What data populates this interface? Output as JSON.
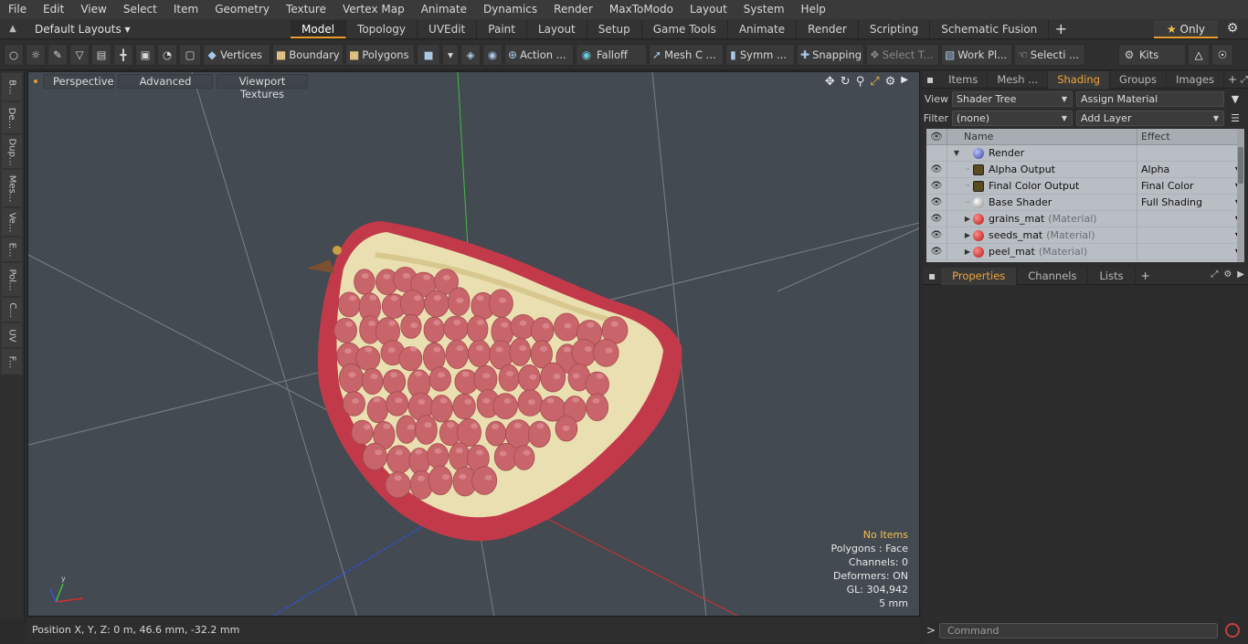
{
  "menu": [
    "File",
    "Edit",
    "View",
    "Select",
    "Item",
    "Geometry",
    "Texture",
    "Vertex Map",
    "Animate",
    "Dynamics",
    "Render",
    "MaxToModo",
    "Layout",
    "System",
    "Help"
  ],
  "layout_selector": "Default Layouts",
  "layout_tabs": [
    {
      "label": "Model",
      "active": true
    },
    {
      "label": "Topology",
      "active": false
    },
    {
      "label": "UVEdit",
      "active": false
    },
    {
      "label": "Paint",
      "active": false
    },
    {
      "label": "Layout",
      "active": false
    },
    {
      "label": "Setup",
      "active": false
    },
    {
      "label": "Game Tools",
      "active": false
    },
    {
      "label": "Animate",
      "active": false
    },
    {
      "label": "Render",
      "active": false
    },
    {
      "label": "Scripting",
      "active": false
    },
    {
      "label": "Schematic Fusion",
      "active": false
    }
  ],
  "only_label": "Only",
  "toolbar": {
    "vertices": "Vertices",
    "boundary": "Boundary",
    "polygons": "Polygons",
    "action": "Action ...",
    "falloff": "Falloff",
    "mesh": "Mesh C ...",
    "symm": "Symm ...",
    "snapping": "Snapping",
    "select_t": "Select T...",
    "workpl": "Work Pl...",
    "selecti": "Selecti ...",
    "kits": "Kits"
  },
  "left_tabs": [
    "B...",
    "De...",
    "Dup...",
    "Mes...",
    "Ve...",
    "E...",
    "Pol...",
    "C...",
    "UV",
    "F..."
  ],
  "viewport": {
    "perspective": "Perspective",
    "advanced": "Advanced",
    "textures": "Viewport Textures",
    "info": {
      "items": "No Items",
      "polygons": "Polygons : Face",
      "channels": "Channels: 0",
      "deformers": "Deformers: ON",
      "gl": "GL: 304,942",
      "scale": "5 mm"
    }
  },
  "status": "Position X, Y, Z:   0 m, 46.6 mm, -32.2 mm",
  "right_panel": {
    "tabs": [
      {
        "label": "Items",
        "active": false
      },
      {
        "label": "Mesh ...",
        "active": false
      },
      {
        "label": "Shading",
        "active": true
      },
      {
        "label": "Groups",
        "active": false
      },
      {
        "label": "Images",
        "active": false
      }
    ],
    "view_label": "View",
    "view_value": "Shader Tree",
    "assign_material": "Assign Material",
    "filter_label": "Filter",
    "filter_value": "(none)",
    "add_layer": "Add Layer",
    "tree_headers": {
      "name": "Name",
      "effect": "Effect"
    },
    "tree_rows": [
      {
        "name": "Render",
        "suffix": "",
        "effect": "",
        "icon": "render-sphere-icon",
        "depth": 0
      },
      {
        "name": "Alpha Output",
        "suffix": "",
        "effect": "Alpha",
        "icon": "render-output-icon",
        "depth": 1
      },
      {
        "name": "Final Color Output",
        "suffix": "",
        "effect": "Final Color",
        "icon": "render-output-icon",
        "depth": 1
      },
      {
        "name": "Base Shader",
        "suffix": "",
        "effect": "Full Shading",
        "icon": "shader-sphere-icon",
        "depth": 1
      },
      {
        "name": "grains_mat",
        "suffix": "(Material)",
        "effect": "",
        "icon": "material-icon",
        "depth": 1
      },
      {
        "name": "seeds_mat",
        "suffix": "(Material)",
        "effect": "",
        "icon": "material-icon",
        "depth": 1
      },
      {
        "name": "peel_mat",
        "suffix": "(Material)",
        "effect": "",
        "icon": "material-icon",
        "depth": 1
      }
    ],
    "bottom_tabs": [
      {
        "label": "Properties",
        "active": true
      },
      {
        "label": "Channels",
        "active": false
      },
      {
        "label": "Lists",
        "active": false
      }
    ],
    "command_placeholder": "Command"
  },
  "colors": {
    "accent": "#e89b2a",
    "viewport_bg": "#434a51",
    "seed": "#c8656a",
    "pith": "#eadfb0",
    "peel": "#c23a4a"
  }
}
